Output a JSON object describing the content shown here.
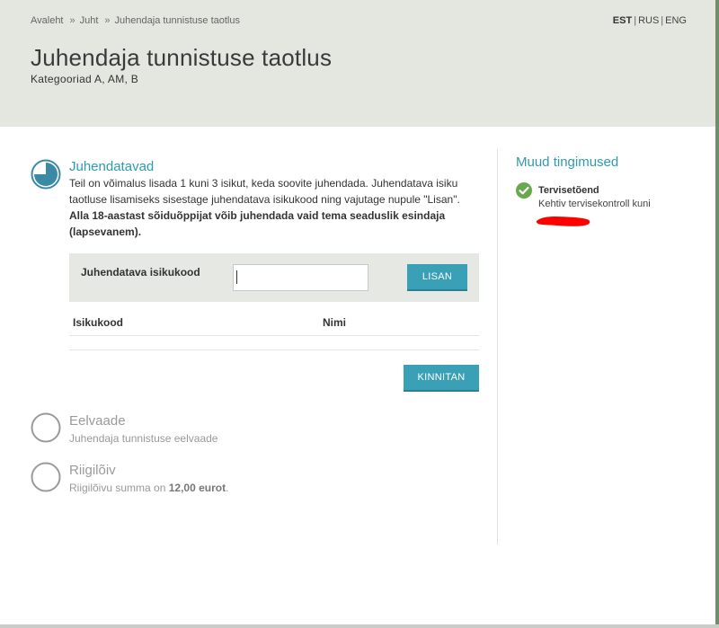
{
  "breadcrumb": {
    "items": [
      "Avaleht",
      "Juht",
      "Juhendaja tunnistuse taotlus"
    ],
    "separator": "»"
  },
  "language": {
    "options": [
      "EST",
      "RUS",
      "ENG"
    ],
    "active": "EST",
    "divider": "|"
  },
  "page": {
    "title": "Juhendaja tunnistuse taotlus",
    "subtitle": "Kategooriad A, AM, B"
  },
  "steps": {
    "juhendatavad": {
      "title": "Juhendatavad",
      "description_plain": "Teil on võimalus lisada 1 kuni 3 isikut, keda soovite juhendada. Juhendatava isiku taotluse lisamiseks sisestage juhendatava isikukood ning vajutage nupule \"Lisan\". ",
      "description_bold": "Alla 18-aastast sõiduõppijat võib juhendada vaid tema seaduslik esindaja (lapsevanem).",
      "form": {
        "label": "Juhendatava isikukood",
        "input_value": "",
        "add_button": "LISAN"
      },
      "table": {
        "columns": [
          "Isikukood",
          "Nimi"
        ],
        "rows": []
      },
      "confirm_button": "KINNITAN"
    },
    "eelvaade": {
      "title": "Eelvaade",
      "subtitle": "Juhendaja tunnistuse eelvaade"
    },
    "riigiloiv": {
      "title": "Riigilõiv",
      "subtitle_prefix": "Riigilõivu summa on ",
      "amount": "12,00 eurot",
      "subtitle_suffix": "."
    }
  },
  "sidebar": {
    "title": "Muud tingimused",
    "conditions": [
      {
        "title": "Tervisetõend",
        "text": "Kehtiv tervisekontroll kuni",
        "status": "ok"
      }
    ]
  },
  "colors": {
    "accent": "#2e9ab0",
    "button": "#3aa0b5",
    "header_bg": "#e4e6e0",
    "success": "#6aa84f",
    "redaction": "#ff0000"
  },
  "icons": {
    "active_step": "progress-pie-icon",
    "inactive_step": "empty-circle-icon",
    "condition_ok": "check-circle-icon"
  }
}
